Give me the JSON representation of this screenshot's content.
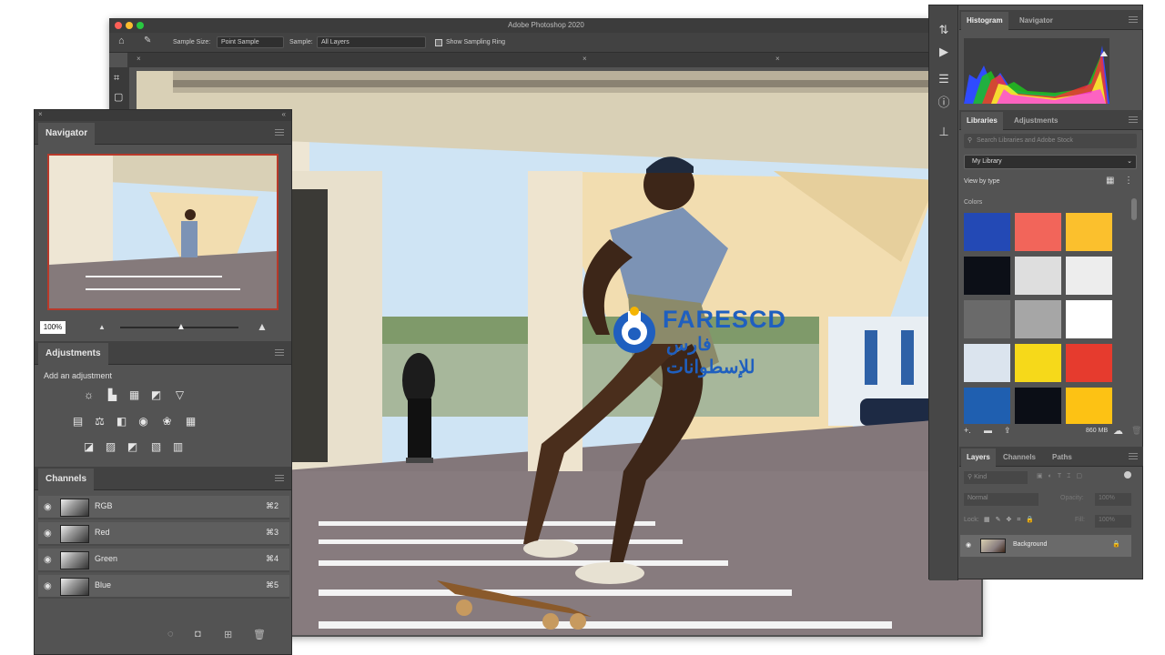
{
  "window": {
    "title": "Adobe Photoshop 2020"
  },
  "options_bar": {
    "sample_size_label": "Sample Size:",
    "sample_size_value": "Point Sample",
    "sample_label": "Sample:",
    "sample_value": "All Layers",
    "show_ring_label": "Show Sampling Ring"
  },
  "navigator": {
    "tab": "Navigator",
    "zoom": "100%"
  },
  "adjustments": {
    "tab": "Adjustments",
    "prompt": "Add an adjustment"
  },
  "channels": {
    "tab": "Channels",
    "rows": [
      {
        "name": "RGB",
        "shortcut": "⌘2"
      },
      {
        "name": "Red",
        "shortcut": "⌘3"
      },
      {
        "name": "Green",
        "shortcut": "⌘4"
      },
      {
        "name": "Blue",
        "shortcut": "⌘5"
      }
    ]
  },
  "histogram": {
    "tabs": [
      "Histogram",
      "Navigator"
    ]
  },
  "libraries": {
    "tabs": [
      "Libraries",
      "Adjustments"
    ],
    "search_placeholder": "Search Libraries and Adobe Stock",
    "library": "My Library",
    "view_by": "View by type",
    "section": "Colors",
    "swatches": [
      "#2349b5",
      "#f2655a",
      "#fbc02d",
      "#0c0f17",
      "#dedede",
      "#ededed",
      "#6a6a6a",
      "#a6a6a6",
      "#ffffff",
      "#dbe4ee",
      "#f6d91a",
      "#e63b2e",
      "#1f5fb0",
      "#0b0e16",
      "#fdc214"
    ],
    "storage": "860 MB"
  },
  "layers": {
    "tabs": [
      "Layers",
      "Channels",
      "Paths"
    ],
    "kind": "Kind",
    "blend": "Normal",
    "opacity_label": "Opacity:",
    "opacity": "100%",
    "lock_label": "Lock:",
    "fill_label": "Fill:",
    "fill": "100%",
    "layer_name": "Background"
  },
  "watermark": {
    "brand": "FARESCD",
    "arabic": "فارس للإسطوانات"
  }
}
